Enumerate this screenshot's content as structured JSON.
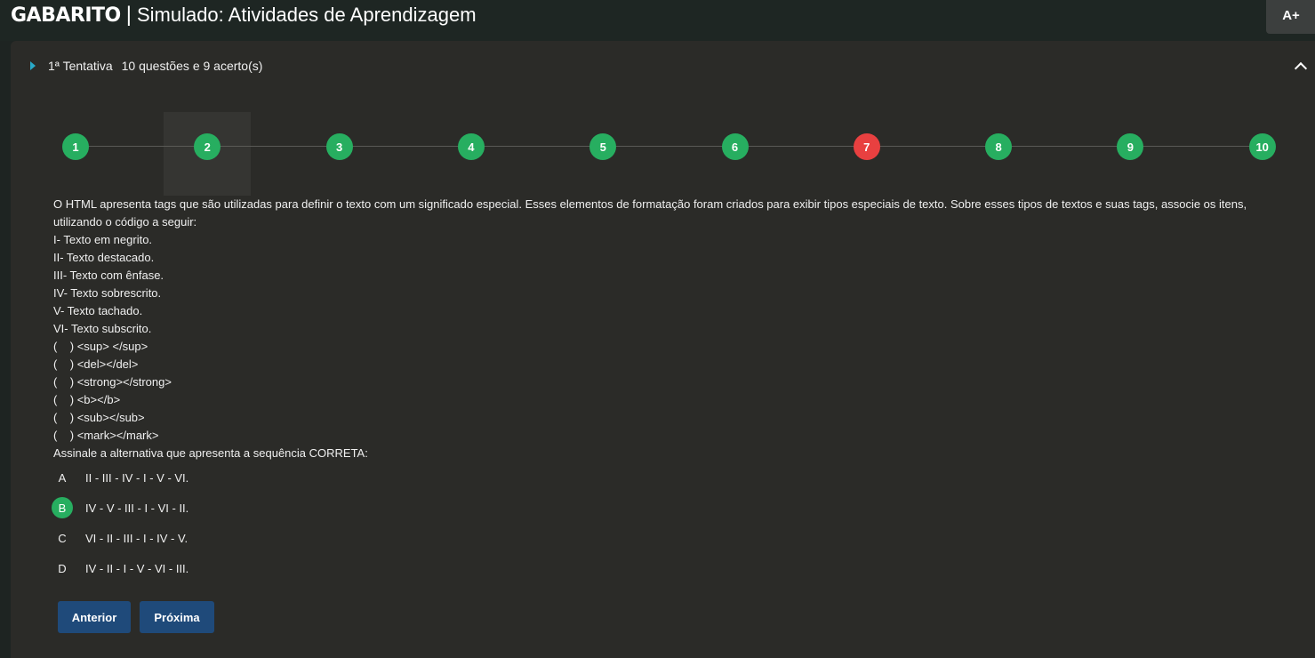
{
  "header": {
    "brand": "GABARITO",
    "separator": "|",
    "subtitle": "Simulado: Atividades de Aprendizagem",
    "font_size_button": "A+"
  },
  "attempt": {
    "label": "1ª Tentativa",
    "summary": "10 questões e 9 acerto(s)"
  },
  "steps": [
    {
      "label": "1",
      "status": "correct"
    },
    {
      "label": "2",
      "status": "correct"
    },
    {
      "label": "3",
      "status": "correct"
    },
    {
      "label": "4",
      "status": "correct"
    },
    {
      "label": "5",
      "status": "correct"
    },
    {
      "label": "6",
      "status": "correct"
    },
    {
      "label": "7",
      "status": "wrong"
    },
    {
      "label": "8",
      "status": "correct"
    },
    {
      "label": "9",
      "status": "correct"
    },
    {
      "label": "10",
      "status": "correct"
    }
  ],
  "question": {
    "statement": "O HTML apresenta tags que são utilizadas para definir o texto com um significado especial. Esses elementos de formatação foram criados para exibir tipos especiais de texto. Sobre esses tipos de textos e suas tags, associe os itens, utilizando o código a seguir:",
    "lines": [
      "I- Texto em negrito.",
      "II- Texto destacado.",
      "III- Texto com ênfase.",
      "IV- Texto sobrescrito.",
      "V- Texto tachado.",
      "VI- Texto subscrito.",
      "(    ) <sup> </sup>",
      "(    ) <del></del>",
      "(    ) <strong></strong>",
      "(    ) <b></b>",
      "(    ) <sub></sub>",
      "(    ) <mark></mark>",
      "Assinale a alternativa que apresenta a sequência CORRETA:"
    ]
  },
  "options": [
    {
      "letter": "A",
      "text": "II - III - IV - I - V - VI.",
      "correct": false
    },
    {
      "letter": "B",
      "text": "IV - V - III - I - VI - II.",
      "correct": true
    },
    {
      "letter": "C",
      "text": "VI - II - III - I - IV - V.",
      "correct": false
    },
    {
      "letter": "D",
      "text": "IV - II - I - V - VI - III.",
      "correct": false
    }
  ],
  "nav": {
    "previous_label": "Anterior",
    "next_label": "Próxima"
  },
  "colors": {
    "correct": "#27ae60",
    "wrong": "#e84040",
    "button": "#1f4a7a",
    "accent": "#29a9c8"
  }
}
